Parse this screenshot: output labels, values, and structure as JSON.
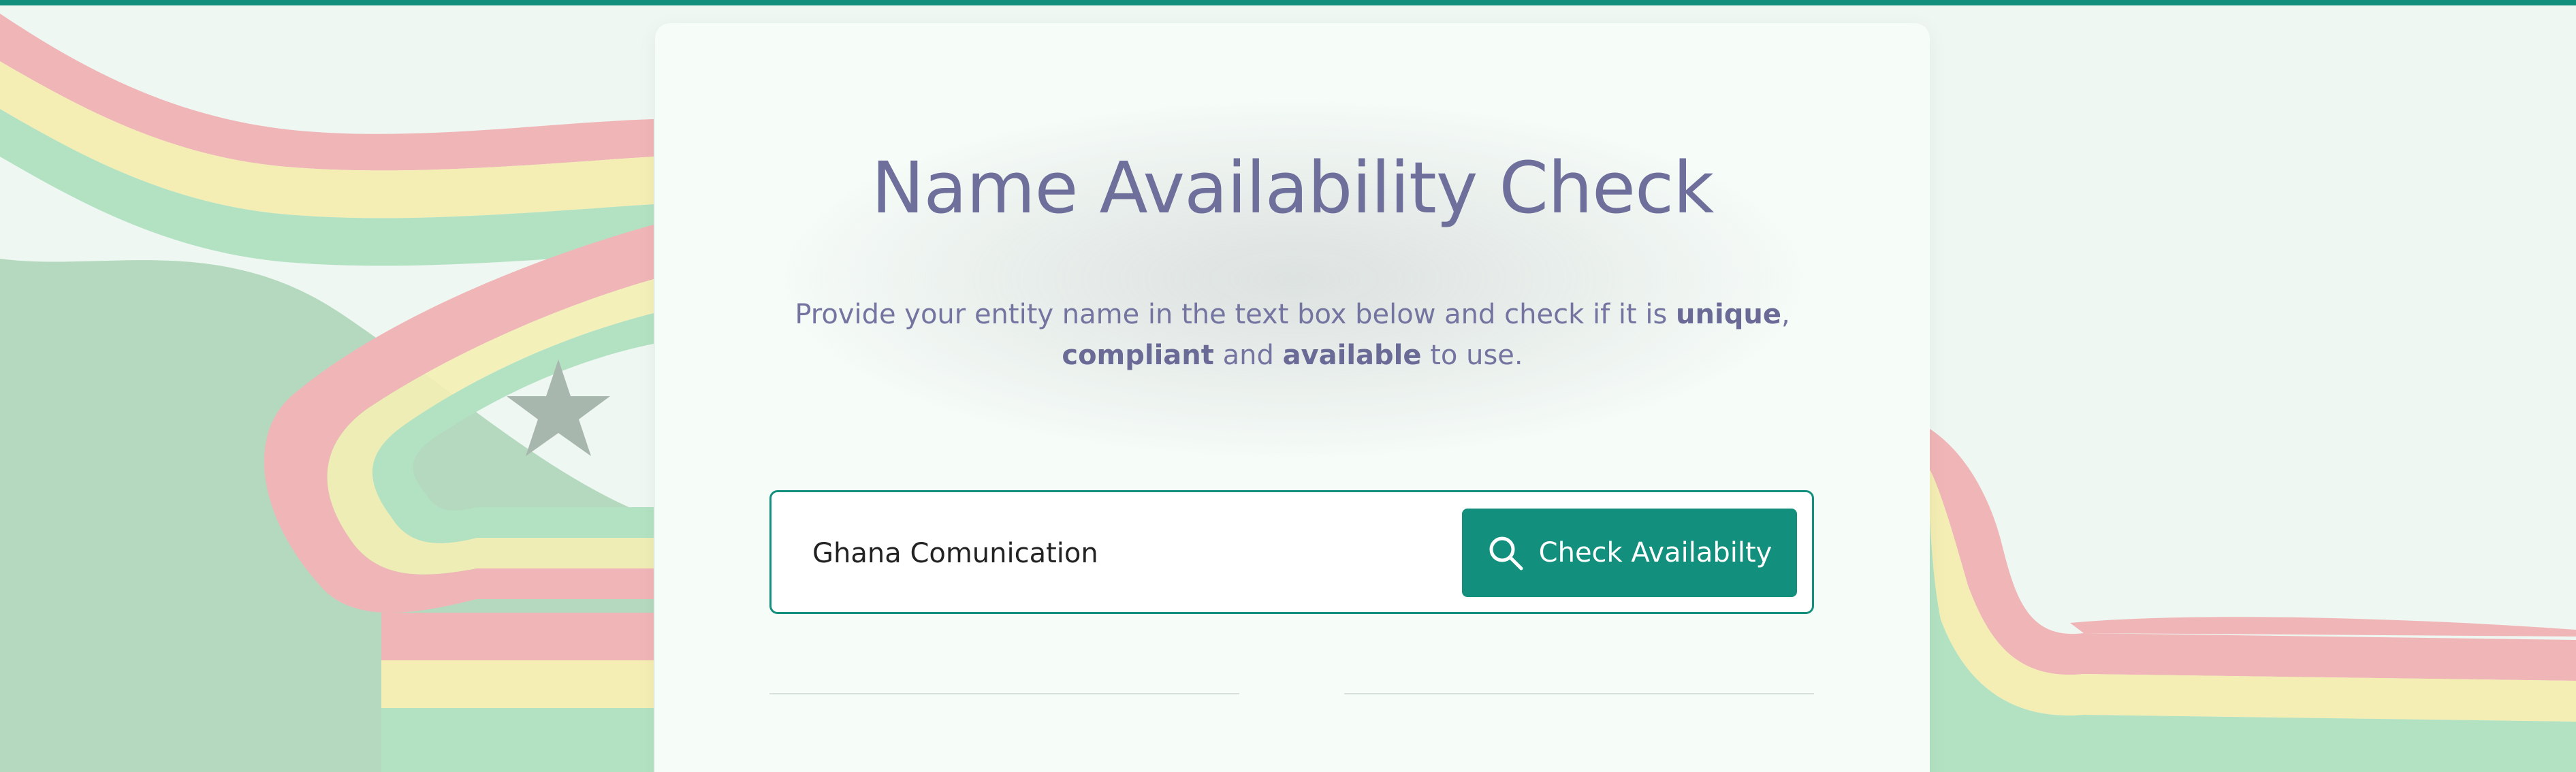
{
  "page": {
    "title": "Name Availability Check",
    "subtitle": {
      "text1": "Provide your entity name in the text box below and check if it is ",
      "bold1": "unique",
      "text2": ", ",
      "bold2": "compliant",
      "text3": " and ",
      "bold3": "available",
      "text4": " to use."
    }
  },
  "search": {
    "value": "Ghana Comunication",
    "button_label": "Check Availabilty",
    "button_icon": "search-icon"
  },
  "colors": {
    "accent": "#13907d",
    "title": "#6f6f9b",
    "background": "#eef7f1"
  },
  "background_decoration": "ghana-flag-ribbon"
}
